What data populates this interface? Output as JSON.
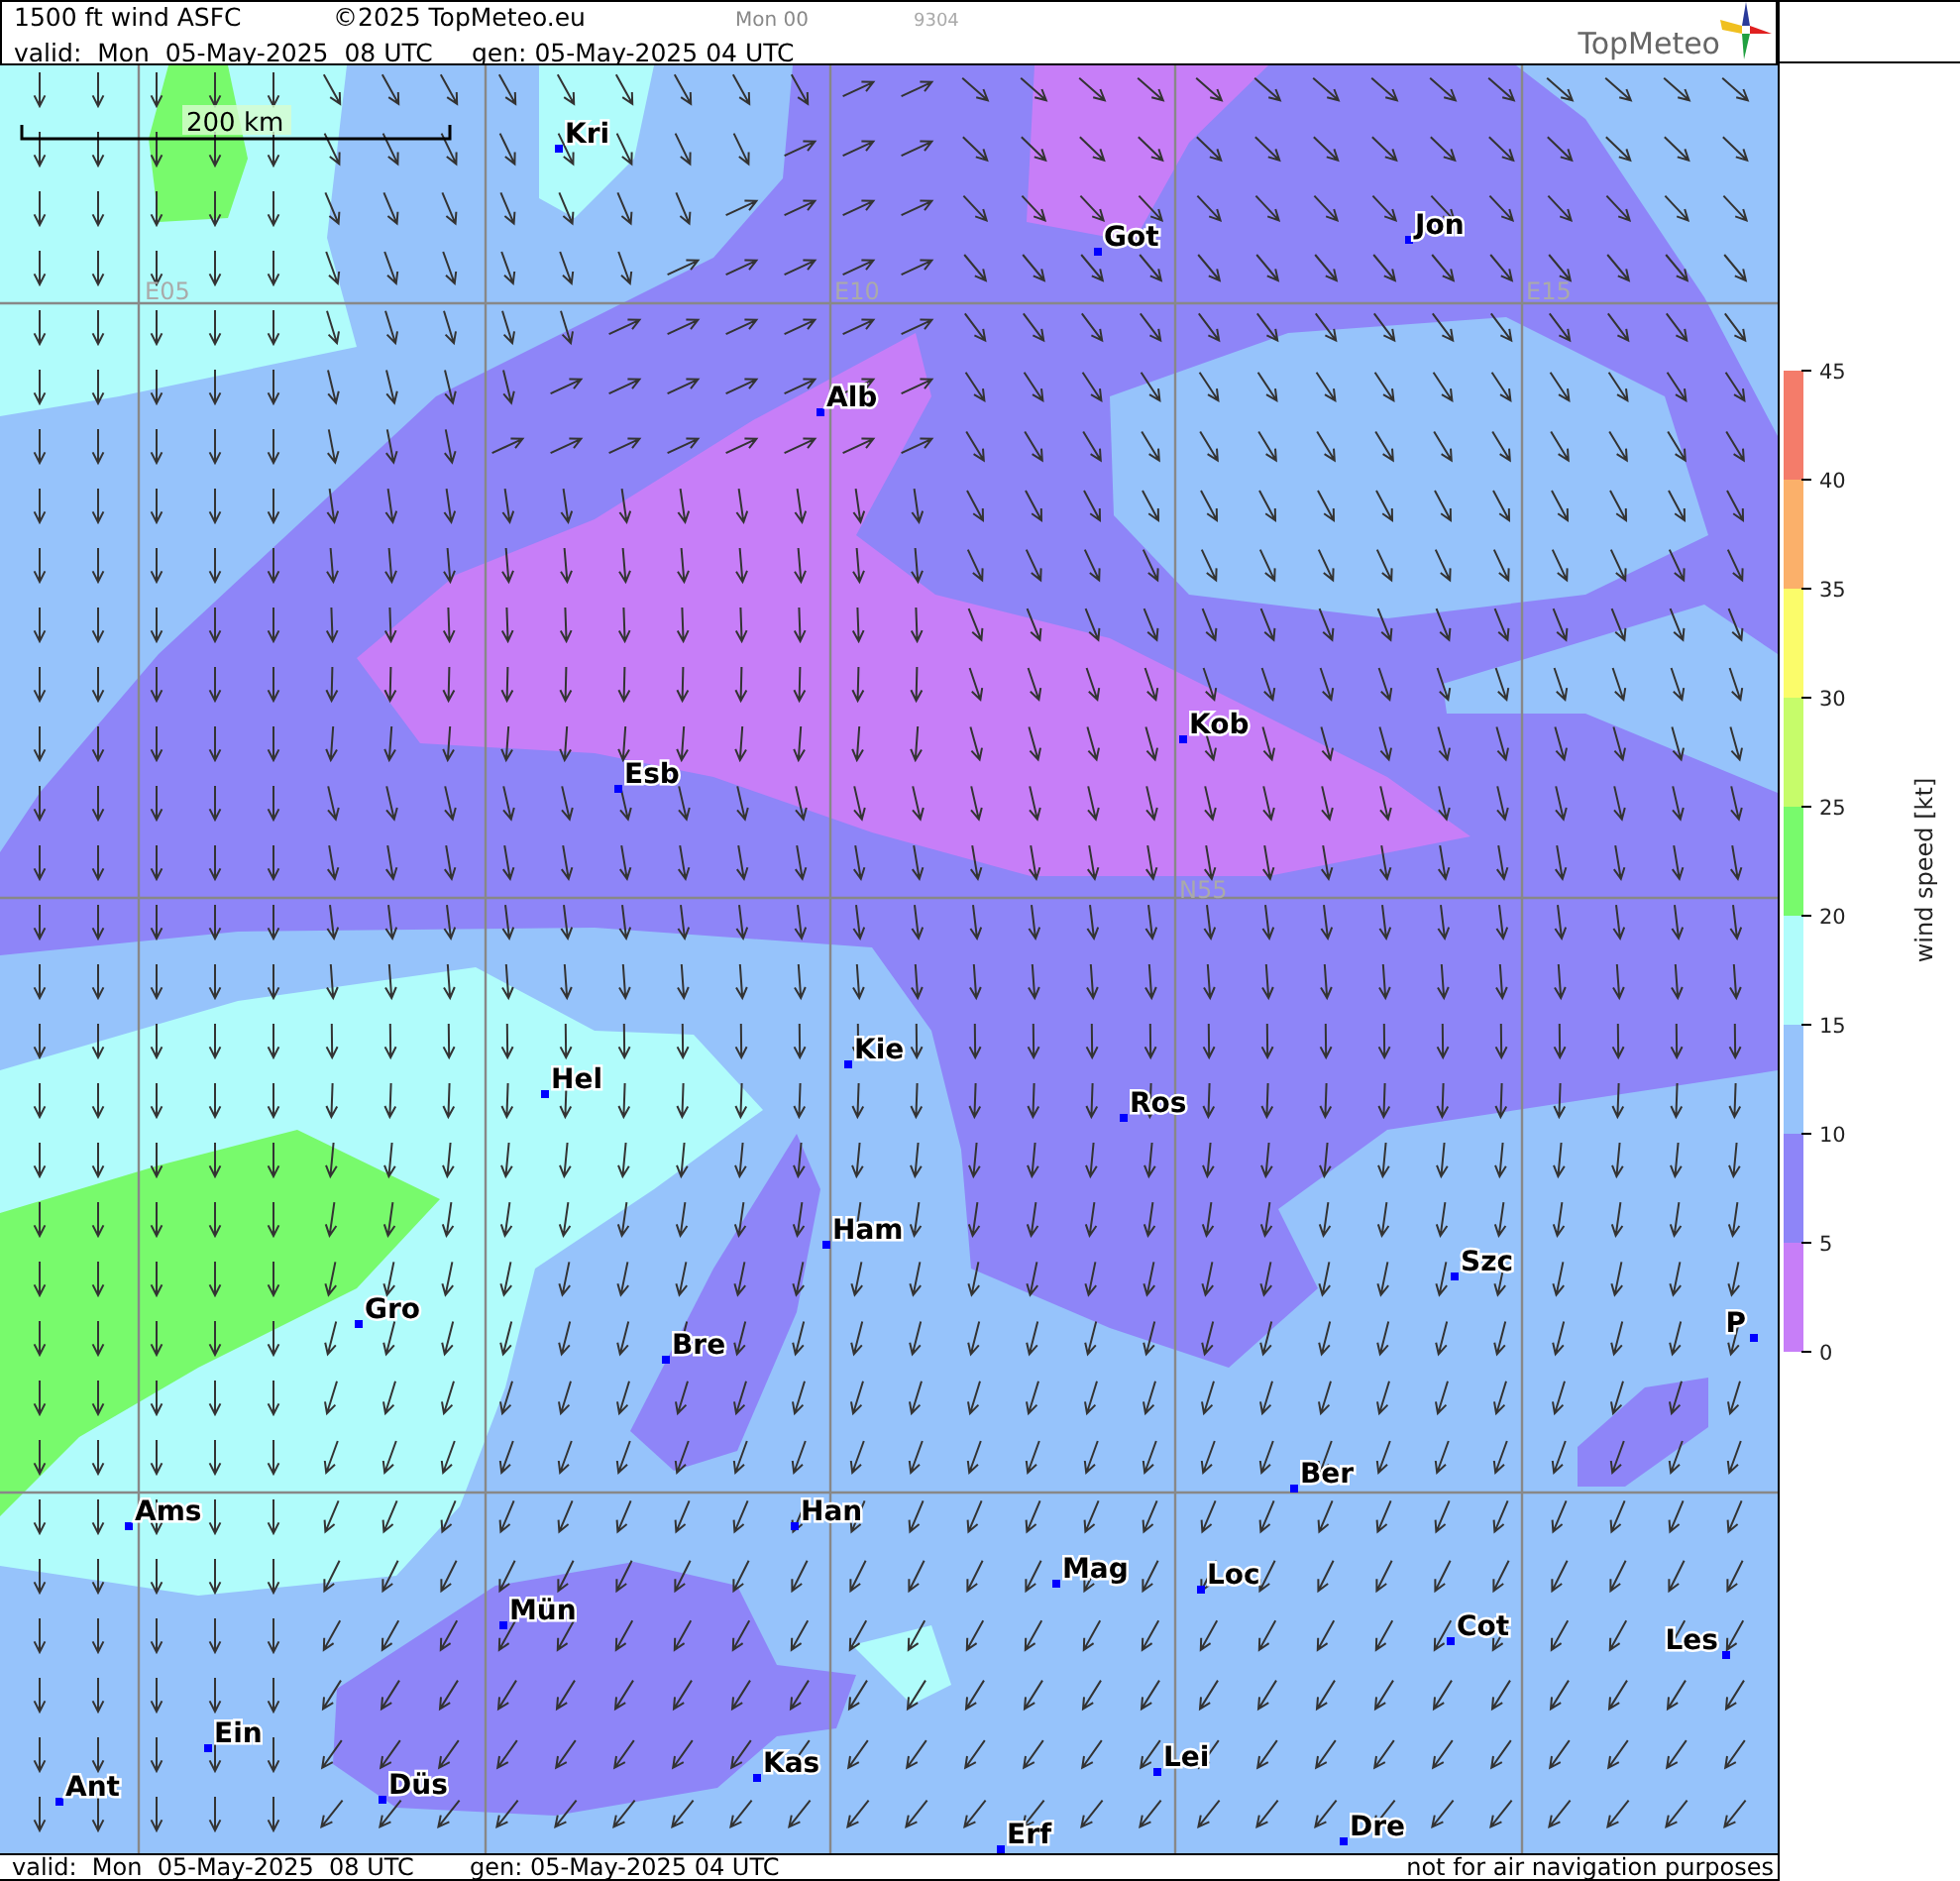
{
  "header": {
    "title": "1500 ft wind ASFC",
    "copyright": "©2025 TopMeteo.eu",
    "run": "Mon 00",
    "code": "9304",
    "valid": "valid:  Mon  05-May-2025  08 UTC",
    "generated": "gen: 05-May-2025 04 UTC",
    "logo": "TopMeteo"
  },
  "map": {
    "scale_label": "200 km",
    "grid_labels": [
      "E05",
      "E10",
      "E15",
      "N55"
    ],
    "cities": [
      {
        "name": "Kri"
      },
      {
        "name": "Got"
      },
      {
        "name": "Jon"
      },
      {
        "name": "Alb"
      },
      {
        "name": "Kob"
      },
      {
        "name": "Esb"
      },
      {
        "name": "Kie"
      },
      {
        "name": "Hel"
      },
      {
        "name": "Ros"
      },
      {
        "name": "Ham"
      },
      {
        "name": "Szc"
      },
      {
        "name": "Gro"
      },
      {
        "name": "Bre"
      },
      {
        "name": "P"
      },
      {
        "name": "Ber"
      },
      {
        "name": "Ams"
      },
      {
        "name": "Han"
      },
      {
        "name": "Mag"
      },
      {
        "name": "Loc"
      },
      {
        "name": "Mün"
      },
      {
        "name": "Cot"
      },
      {
        "name": "Les"
      },
      {
        "name": "Ein"
      },
      {
        "name": "Lei"
      },
      {
        "name": "Kas"
      },
      {
        "name": "Ant"
      },
      {
        "name": "Düs"
      },
      {
        "name": "Dre"
      },
      {
        "name": "Erf"
      }
    ]
  },
  "legend": {
    "title": "wind speed [kt]",
    "ticks": [
      "45",
      "40",
      "35",
      "30",
      "25",
      "20",
      "15",
      "10",
      "5",
      "0"
    ],
    "bands": [
      {
        "color": "#f47c6a"
      },
      {
        "color": "#fbb06a"
      },
      {
        "color": "#fbfc6a"
      },
      {
        "color": "#c6fc6a"
      },
      {
        "color": "#78fa6c"
      },
      {
        "color": "#b0fcfb"
      },
      {
        "color": "#96c3fb"
      },
      {
        "color": "#8e85f8"
      },
      {
        "color": "#c77ef8"
      }
    ]
  },
  "footer": {
    "valid": "valid:  Mon  05-May-2025  08 UTC",
    "generated": "gen: 05-May-2025 04 UTC",
    "disclaimer": "not for air navigation purposes"
  }
}
